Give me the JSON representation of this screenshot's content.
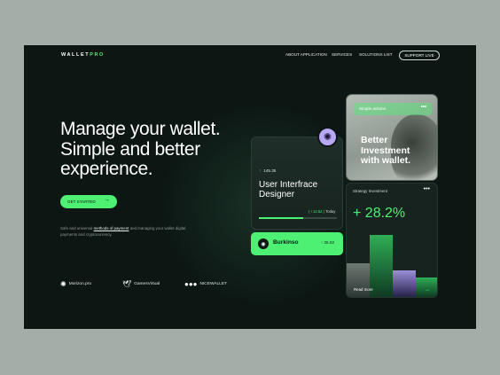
{
  "brand": {
    "name": "WALLET",
    "suffix": "PRO"
  },
  "nav": [
    "ABOUT APPLICATION",
    "SERVICES",
    "SOLUTIONS LIST"
  ],
  "support_label": "SUPPORT LIVE",
  "hero": {
    "lines": [
      "Manage your wallet.",
      "Simple and better",
      "experience."
    ]
  },
  "cta_label": "GET STARTED",
  "description": {
    "pre": "Safe and universal ",
    "link": "methods of payment",
    "post": " and managing your wallet digital payments and cryptocurrency."
  },
  "partners": [
    {
      "name": "Morizon.pro",
      "icon": "sun-icon"
    },
    {
      "name": "GamesVirtual",
      "icon": "bird-icon"
    },
    {
      "name": "NICEWALLET",
      "icon": "dots-icon"
    }
  ],
  "ui_card": {
    "value": "145.35",
    "title": [
      "User Interfrace",
      "Designer"
    ],
    "change": "( +12.52 )",
    "period": "Today",
    "progress": 0.57
  },
  "user_pill": {
    "name": "Burkinso",
    "value": "25.02"
  },
  "promo": {
    "small": "Simple actions",
    "more": "•••",
    "big": [
      "Better",
      "Investment",
      "with wallet."
    ]
  },
  "strategy": {
    "label": "Strategy Investment",
    "more": "•••",
    "percent": "+ 28.2%",
    "read_more": "Read more"
  },
  "colors": {
    "accent": "#4ef073",
    "background": "#0c1613",
    "card": "#17231f",
    "badge": "#b9a8f5"
  }
}
